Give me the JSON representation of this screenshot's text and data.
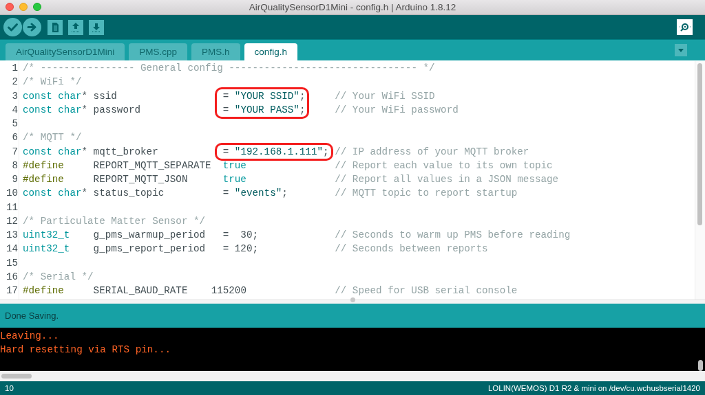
{
  "window": {
    "title": "AirQualitySensorD1Mini - config.h | Arduino 1.8.12",
    "controls": [
      {
        "kind": "close"
      },
      {
        "kind": "minimize"
      },
      {
        "kind": "zoom"
      }
    ]
  },
  "toolbar": {
    "buttons": [
      {
        "kind": "verify"
      },
      {
        "kind": "upload"
      },
      {
        "kind": "new"
      },
      {
        "kind": "open"
      },
      {
        "kind": "save"
      }
    ],
    "right_button": {
      "kind": "serial-monitor"
    }
  },
  "tabs": [
    {
      "label": "AirQualitySensorD1Mini",
      "selected": false
    },
    {
      "label": "PMS.cpp",
      "selected": false
    },
    {
      "label": "PMS.h",
      "selected": false
    },
    {
      "label": "config.h",
      "selected": true
    }
  ],
  "editor": {
    "lines": [
      {
        "number": "1",
        "circled": false,
        "comment": "/* ---------------- General config -------------------------------- */"
      },
      {
        "number": "2",
        "circled": false,
        "comment": "/* WiFi */"
      },
      {
        "number": "3",
        "circled": true,
        "left": [
          {
            "kind": "keyword",
            "text": "const char"
          },
          {
            "kind": "plain",
            "text": "* ssid"
          }
        ],
        "value": [
          {
            "kind": "operator",
            "text": "="
          },
          {
            "kind": "string",
            "text": "\"YOUR SSID\""
          },
          {
            "kind": "plain",
            "text": ";"
          }
        ],
        "comment": "// Your WiFi SSID"
      },
      {
        "number": "4",
        "circled": true,
        "left": [
          {
            "kind": "keyword",
            "text": "const char"
          },
          {
            "kind": "plain",
            "text": "* password"
          }
        ],
        "value": [
          {
            "kind": "operator",
            "text": "="
          },
          {
            "kind": "string",
            "text": "\"YOUR PASS\""
          },
          {
            "kind": "plain",
            "text": ";"
          }
        ],
        "comment": "// Your WiFi password"
      },
      {
        "number": "5",
        "circled": false
      },
      {
        "number": "6",
        "circled": false,
        "comment": "/* MQTT */"
      },
      {
        "number": "7",
        "circled": true,
        "left": [
          {
            "kind": "keyword",
            "text": "const char"
          },
          {
            "kind": "plain",
            "text": "* mqtt_broker"
          }
        ],
        "value": [
          {
            "kind": "operator",
            "text": "="
          },
          {
            "kind": "string",
            "text": "\"192.168.1.111\""
          },
          {
            "kind": "plain",
            "text": ";"
          }
        ],
        "comment": "// IP address of your MQTT broker"
      },
      {
        "number": "8",
        "circled": false,
        "left": [
          {
            "kind": "preprocessor",
            "text": "#define"
          }
        ],
        "middle": [
          {
            "kind": "plain",
            "text": "REPORT_MQTT_SEPARATE"
          }
        ],
        "value": [
          {
            "kind": "keyword",
            "text": "true"
          }
        ],
        "comment": "// Report each value to its own topic"
      },
      {
        "number": "9",
        "circled": false,
        "left": [
          {
            "kind": "preprocessor",
            "text": "#define"
          }
        ],
        "middle": [
          {
            "kind": "plain",
            "text": "REPORT_MQTT_JSON"
          }
        ],
        "value": [
          {
            "kind": "keyword",
            "text": "true"
          }
        ],
        "comment": "// Report all values in a JSON message"
      },
      {
        "number": "10",
        "circled": false,
        "left": [
          {
            "kind": "keyword",
            "text": "const char"
          },
          {
            "kind": "plain",
            "text": "* status_topic"
          }
        ],
        "value": [
          {
            "kind": "operator",
            "text": "="
          },
          {
            "kind": "string",
            "text": "\"events\""
          },
          {
            "kind": "plain",
            "text": ";"
          }
        ],
        "comment": "// MQTT topic to report startup"
      },
      {
        "number": "11",
        "circled": false
      },
      {
        "number": "12",
        "circled": false,
        "comment": "/* Particulate Matter Sensor */"
      },
      {
        "number": "13",
        "circled": false,
        "left": [
          {
            "kind": "keyword",
            "text": "uint32_t"
          }
        ],
        "middle": [
          {
            "kind": "plain",
            "text": "g_pms_warmup_period"
          }
        ],
        "value": [
          {
            "kind": "plain",
            "text": "=  30;"
          }
        ],
        "comment": "// Seconds to warm up PMS before reading"
      },
      {
        "number": "14",
        "circled": false,
        "left": [
          {
            "kind": "keyword",
            "text": "uint32_t"
          }
        ],
        "middle": [
          {
            "kind": "plain",
            "text": "g_pms_report_period"
          }
        ],
        "value": [
          {
            "kind": "plain",
            "text": "= 120;"
          }
        ],
        "comment": "// Seconds between reports"
      },
      {
        "number": "15",
        "circled": false
      },
      {
        "number": "16",
        "circled": false,
        "comment": "/* Serial */"
      },
      {
        "number": "17",
        "circled": false,
        "left": [
          {
            "kind": "preprocessor",
            "text": "#define"
          }
        ],
        "middle": [
          {
            "kind": "plain",
            "text": "SERIAL_BAUD_RATE"
          }
        ],
        "constant": [
          {
            "kind": "plain",
            "text": "115200"
          }
        ],
        "comment": "// Speed for USB serial console"
      }
    ]
  },
  "message": "Done Saving.",
  "console": {
    "lines": [
      "Leaving...",
      "Hard resetting via RTS pin..."
    ]
  },
  "status_bar": {
    "line": "10",
    "board": "LOLIN(WEMOS) D1 R2 & mini on /dev/cu.wchusbserial1420"
  }
}
